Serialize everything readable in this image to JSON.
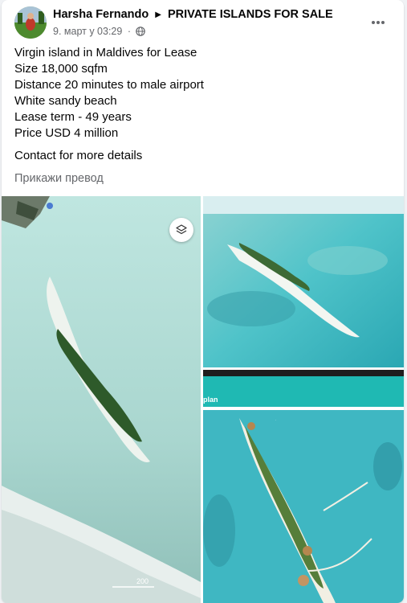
{
  "post": {
    "author": "Harsha Fernando",
    "group": "PRIVATE ISLANDS FOR SALE",
    "timestamp": "9. март у 03:29",
    "separator": "·",
    "lines": [
      "Virgin island in Maldives for Lease",
      "Size 18,000 sqfm",
      "Distance 20 minutes to male airport",
      "White sandy beach",
      "Lease term - 49 years",
      "Price USD 4 million"
    ],
    "contact": "Contact for more details",
    "translate_label": "Прикажи превод"
  },
  "photos": {
    "plan_label": "plan",
    "scale_text": "200"
  },
  "icons": {
    "more": "more-horizontal-icon",
    "audience": "globe-icon",
    "layers": "layers-icon"
  },
  "colors": {
    "secondary_text": "#65676b",
    "primary_text": "#050505",
    "sea": "#4fc3c9",
    "teal_band": "#1fb9b3"
  }
}
